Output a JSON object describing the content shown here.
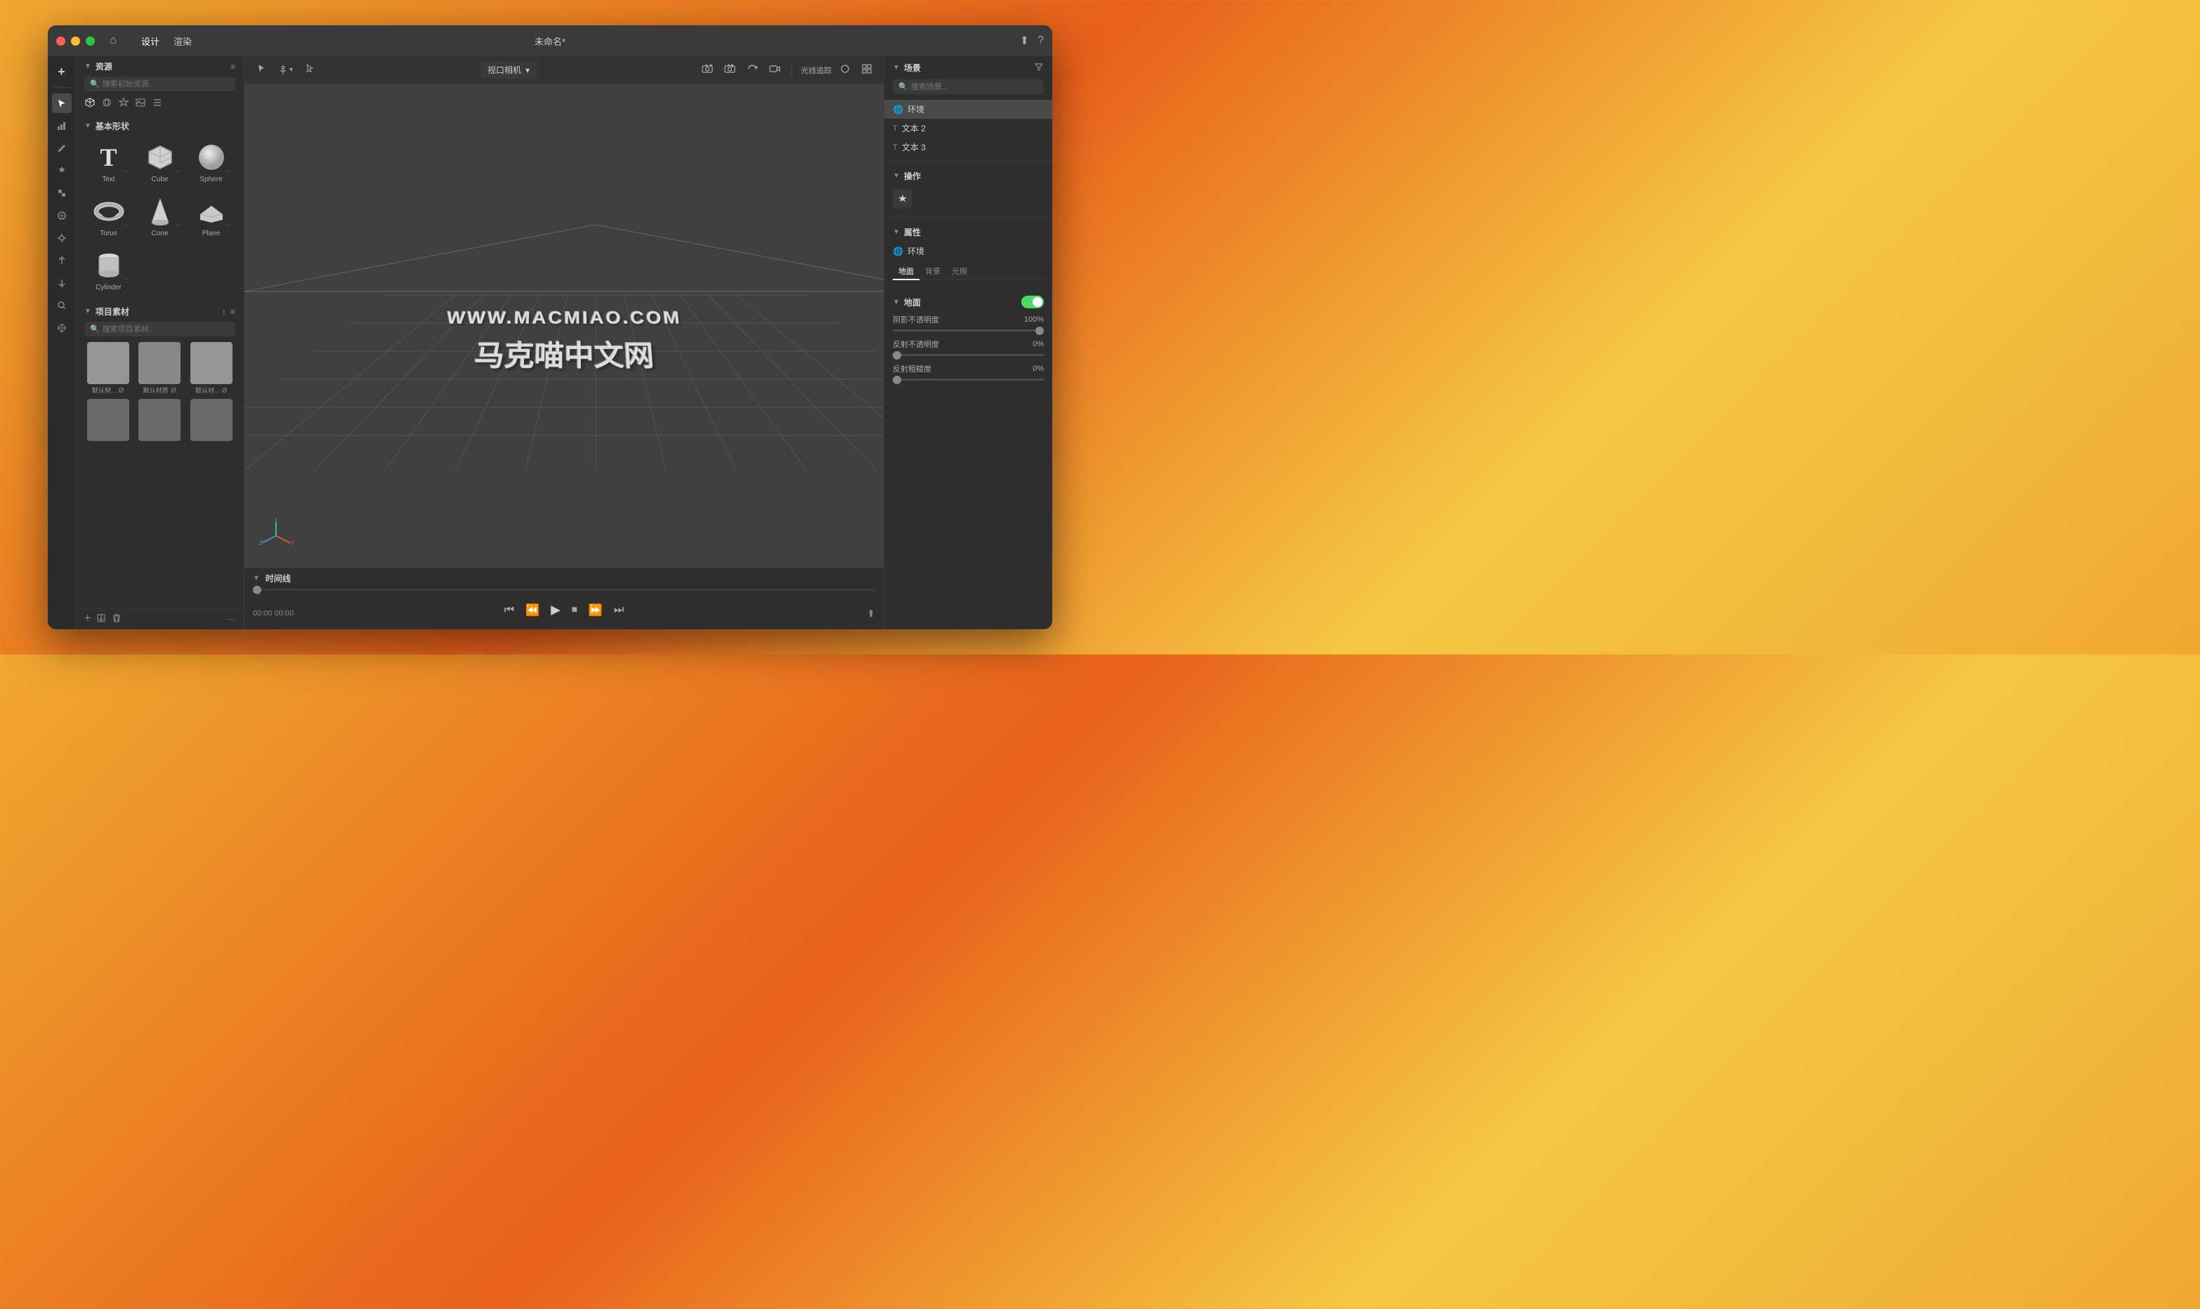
{
  "app": {
    "title": "未命名*",
    "traffic_lights": [
      "close",
      "minimize",
      "maximize"
    ],
    "nav_home_icon": "⌂",
    "nav_items": [
      {
        "label": "设计",
        "active": true
      },
      {
        "label": "渲染",
        "active": false
      }
    ],
    "title_bar_right": [
      "share-icon",
      "help-icon"
    ]
  },
  "left_toolbar": {
    "tools": [
      {
        "icon": "+",
        "name": "add-tool"
      },
      {
        "icon": "↖",
        "name": "select-tool",
        "active": true
      },
      {
        "icon": "📊",
        "name": "chart-tool"
      },
      {
        "icon": "✏",
        "name": "edit-tool"
      },
      {
        "icon": "✦",
        "name": "magic-tool"
      },
      {
        "icon": "⬡",
        "name": "object-tool"
      },
      {
        "icon": "✳",
        "name": "effect-tool"
      },
      {
        "icon": "⟳",
        "name": "transform-tool"
      },
      {
        "icon": "⊕",
        "name": "add-object-tool"
      },
      {
        "icon": "⊖",
        "name": "remove-tool"
      },
      {
        "icon": "🔍",
        "name": "zoom-tool"
      },
      {
        "icon": "✋",
        "name": "pan-tool"
      }
    ]
  },
  "assets_panel": {
    "title": "资源",
    "search_placeholder": "搜索初始资源...",
    "filter_icons": [
      "cube-icon",
      "sphere-icon",
      "star-icon",
      "image-icon",
      "list-icon"
    ],
    "basic_shapes_section": "基本形状",
    "shapes": [
      {
        "label": "Text",
        "type": "text"
      },
      {
        "label": "Cube",
        "type": "cube"
      },
      {
        "label": "Sphere",
        "type": "sphere"
      },
      {
        "label": "Torus",
        "type": "torus"
      },
      {
        "label": "Cone",
        "type": "cone"
      },
      {
        "label": "Plane",
        "type": "plane"
      },
      {
        "label": "Cylinder",
        "type": "cylinder"
      }
    ],
    "project_materials_section": "项目素材",
    "materials_search_placeholder": "搜索项目素材...",
    "materials": [
      {
        "label": "默认材...  ∅"
      },
      {
        "label": "默认材质  ∅"
      },
      {
        "label": "默认材...  ∅"
      },
      {
        "label": ""
      },
      {
        "label": ""
      },
      {
        "label": ""
      }
    ],
    "bottom_buttons": [
      "+",
      "📁",
      "🗑",
      "···"
    ]
  },
  "viewport": {
    "toolbar": {
      "tools": [
        "cursor-tool",
        "anchor-tool",
        "pointer-tool"
      ],
      "camera_label": "视口相机",
      "right_tools": [
        "camera-add",
        "camera-edit",
        "camera-rotate",
        "camera-record",
        "raytracing-label",
        "circle-icon",
        "grid-icon"
      ]
    },
    "raytracing_label": "光线追踪",
    "scene_text": {
      "line1": "WWW.MACMIAO.COM",
      "line2": "马克喵中文网"
    },
    "axis_labels": [
      "X",
      "Y",
      "Z"
    ]
  },
  "timeline": {
    "title": "时间线",
    "time_current": "00:00",
    "time_total": "00:00",
    "controls": [
      "skip-back",
      "step-back",
      "play",
      "stop",
      "step-forward",
      "skip-forward"
    ]
  },
  "scene_panel": {
    "title": "场景",
    "search_placeholder": "搜索场景...",
    "items": [
      {
        "label": "环境",
        "icon": "🌐",
        "active": true
      },
      {
        "label": "文本 2",
        "icon": "T"
      },
      {
        "label": "文本 3",
        "icon": "T"
      }
    ]
  },
  "operations_panel": {
    "title": "操作",
    "button_icon": "✦"
  },
  "properties_panel": {
    "title": "属性",
    "env_label": "环境",
    "tabs": [
      {
        "label": "地面",
        "active": true
      },
      {
        "label": "背景",
        "active": false
      },
      {
        "label": "光照",
        "active": false
      }
    ],
    "ground_section": {
      "title": "地面",
      "toggle_on": true
    },
    "properties": [
      {
        "label": "阴影不透明度",
        "value": "100%",
        "slider_pos": "right"
      },
      {
        "label": "反射不透明度",
        "value": "0%",
        "slider_pos": "left"
      },
      {
        "label": "反射粗糙度",
        "value": "0%",
        "slider_pos": "left"
      }
    ]
  },
  "colors": {
    "bg": "#2b2b2b",
    "panel": "#2e2e2e",
    "toolbar": "#333333",
    "active_item": "#4a4a4a",
    "border": "#3a3a3a",
    "text_primary": "#cccccc",
    "text_secondary": "#aaaaaa",
    "text_muted": "#888888",
    "toggle_on": "#4cd964",
    "accent": "#4cd964"
  }
}
